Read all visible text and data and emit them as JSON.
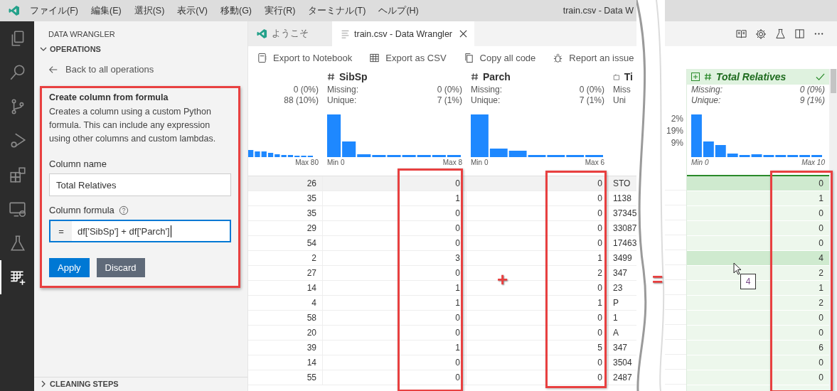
{
  "menu": [
    "ファイル(F)",
    "編集(E)",
    "選択(S)",
    "表示(V)",
    "移動(G)",
    "実行(R)",
    "ターミナル(T)",
    "ヘルプ(H)"
  ],
  "window": {
    "title": "train.csv - Data W"
  },
  "activity_bar": [
    {
      "kind": "explorer",
      "selected": false
    },
    {
      "kind": "search",
      "selected": false
    },
    {
      "kind": "source-control",
      "selected": false
    },
    {
      "kind": "run",
      "selected": false
    },
    {
      "kind": "extensions",
      "selected": false
    },
    {
      "kind": "remote",
      "selected": false
    },
    {
      "kind": "testing",
      "selected": false
    },
    {
      "kind": "data",
      "selected": true
    }
  ],
  "sidebar": {
    "title": "DATA WRANGLER",
    "section": {
      "label": "OPERATIONS",
      "expanded": true
    },
    "back_link": "Back to all operations",
    "operation": {
      "title": "Create column from formula",
      "description": "Creates a column using a custom Python formula. This can include any expression using other columns and custom lambdas.",
      "name_label": "Column name",
      "name_value": "Total Relatives",
      "formula_label": "Column formula",
      "formula_prefix": "=",
      "formula_value": "df['SibSp'] + df['Parch']",
      "buttons": [
        {
          "label": "Apply",
          "kind": "primary"
        },
        {
          "label": "Discard",
          "kind": "secondary"
        }
      ]
    },
    "footer_section": {
      "label": "CLEANING STEPS",
      "expanded": false
    }
  },
  "tabs": [
    {
      "label": "ようこそ",
      "kind": "welcome",
      "selected": false
    },
    {
      "label": "train.csv - Data Wrangler",
      "kind": "file",
      "selected": true
    }
  ],
  "toolbar": [
    {
      "label": "Export to Notebook",
      "kind": "notebook"
    },
    {
      "label": "Export as CSV",
      "kind": "table"
    },
    {
      "label": "Copy all code",
      "kind": "copy"
    },
    {
      "label": "Report an issue",
      "kind": "bug"
    }
  ],
  "columns": [
    {
      "kind": "partial",
      "stats": [
        {
          "value": "0 (0%)"
        },
        {
          "value": "88 (10%)"
        }
      ],
      "max_label": "Max 80"
    },
    {
      "kind": "number",
      "name": "SibSp",
      "stats": [
        {
          "label": "Missing:",
          "value": "0 (0%)"
        },
        {
          "label": "Unique:",
          "value": "7 (1%)"
        }
      ],
      "min_label": "Min 0",
      "max_label": "Max 8"
    },
    {
      "kind": "number",
      "name": "Parch",
      "stats": [
        {
          "label": "Missing:",
          "value": "0 (0%)"
        },
        {
          "label": "Unique:",
          "value": "7 (1%)"
        }
      ],
      "min_label": "Min 0",
      "max_label": "Max 6"
    },
    {
      "kind": "text",
      "name": "Ti",
      "stats": [
        {
          "label": "Miss"
        },
        {
          "label": "Uni"
        }
      ]
    }
  ],
  "rows": [
    {
      "cells": [
        "26",
        "0",
        "0",
        "STO"
      ],
      "selected": true
    },
    {
      "cells": [
        "35",
        "1",
        "0",
        "1138"
      ],
      "selected": false
    },
    {
      "cells": [
        "35",
        "0",
        "0",
        "37345"
      ],
      "selected": false
    },
    {
      "cells": [
        "29",
        "0",
        "0",
        "33087"
      ],
      "selected": false
    },
    {
      "cells": [
        "54",
        "0",
        "0",
        "17463"
      ],
      "selected": false
    },
    {
      "cells": [
        "2",
        "3",
        "1",
        "3499"
      ],
      "selected": false
    },
    {
      "cells": [
        "27",
        "0",
        "2",
        "347"
      ],
      "selected": false
    },
    {
      "cells": [
        "14",
        "1",
        "0",
        "23"
      ],
      "selected": false
    },
    {
      "cells": [
        "4",
        "1",
        "1",
        "P"
      ],
      "selected": false
    },
    {
      "cells": [
        "58",
        "0",
        "0",
        "1"
      ],
      "selected": false
    },
    {
      "cells": [
        "20",
        "0",
        "0",
        "A"
      ],
      "selected": false
    },
    {
      "cells": [
        "39",
        "1",
        "5",
        "347"
      ],
      "selected": false
    },
    {
      "cells": [
        "14",
        "0",
        "0",
        "3504"
      ],
      "selected": false
    },
    {
      "cells": [
        "55",
        "0",
        "0",
        "2487"
      ],
      "selected": false
    }
  ],
  "operators": [
    "+",
    "="
  ],
  "right_fragment": [
    "2%",
    "19%",
    "9%"
  ],
  "new_column": {
    "name": "Total Relatives",
    "stats": [
      {
        "label": "Missing:",
        "value": "0 (0%)"
      },
      {
        "label": "Unique:",
        "value": "9 (1%)"
      }
    ],
    "min_label": "Min 0",
    "max_label": "Max 10",
    "rows": [
      {
        "value": "0",
        "highlighted": true
      },
      {
        "value": "1",
        "highlighted": false
      },
      {
        "value": "0",
        "highlighted": false
      },
      {
        "value": "0",
        "highlighted": false
      },
      {
        "value": "0",
        "highlighted": false
      },
      {
        "value": "4",
        "highlighted": true
      },
      {
        "value": "2",
        "highlighted": false
      },
      {
        "value": "1",
        "highlighted": false
      },
      {
        "value": "2",
        "highlighted": false
      },
      {
        "value": "0",
        "highlighted": false
      },
      {
        "value": "0",
        "highlighted": false
      },
      {
        "value": "6",
        "highlighted": false
      },
      {
        "value": "0",
        "highlighted": false
      },
      {
        "value": "0",
        "highlighted": false
      }
    ]
  },
  "tooltip": "4"
}
